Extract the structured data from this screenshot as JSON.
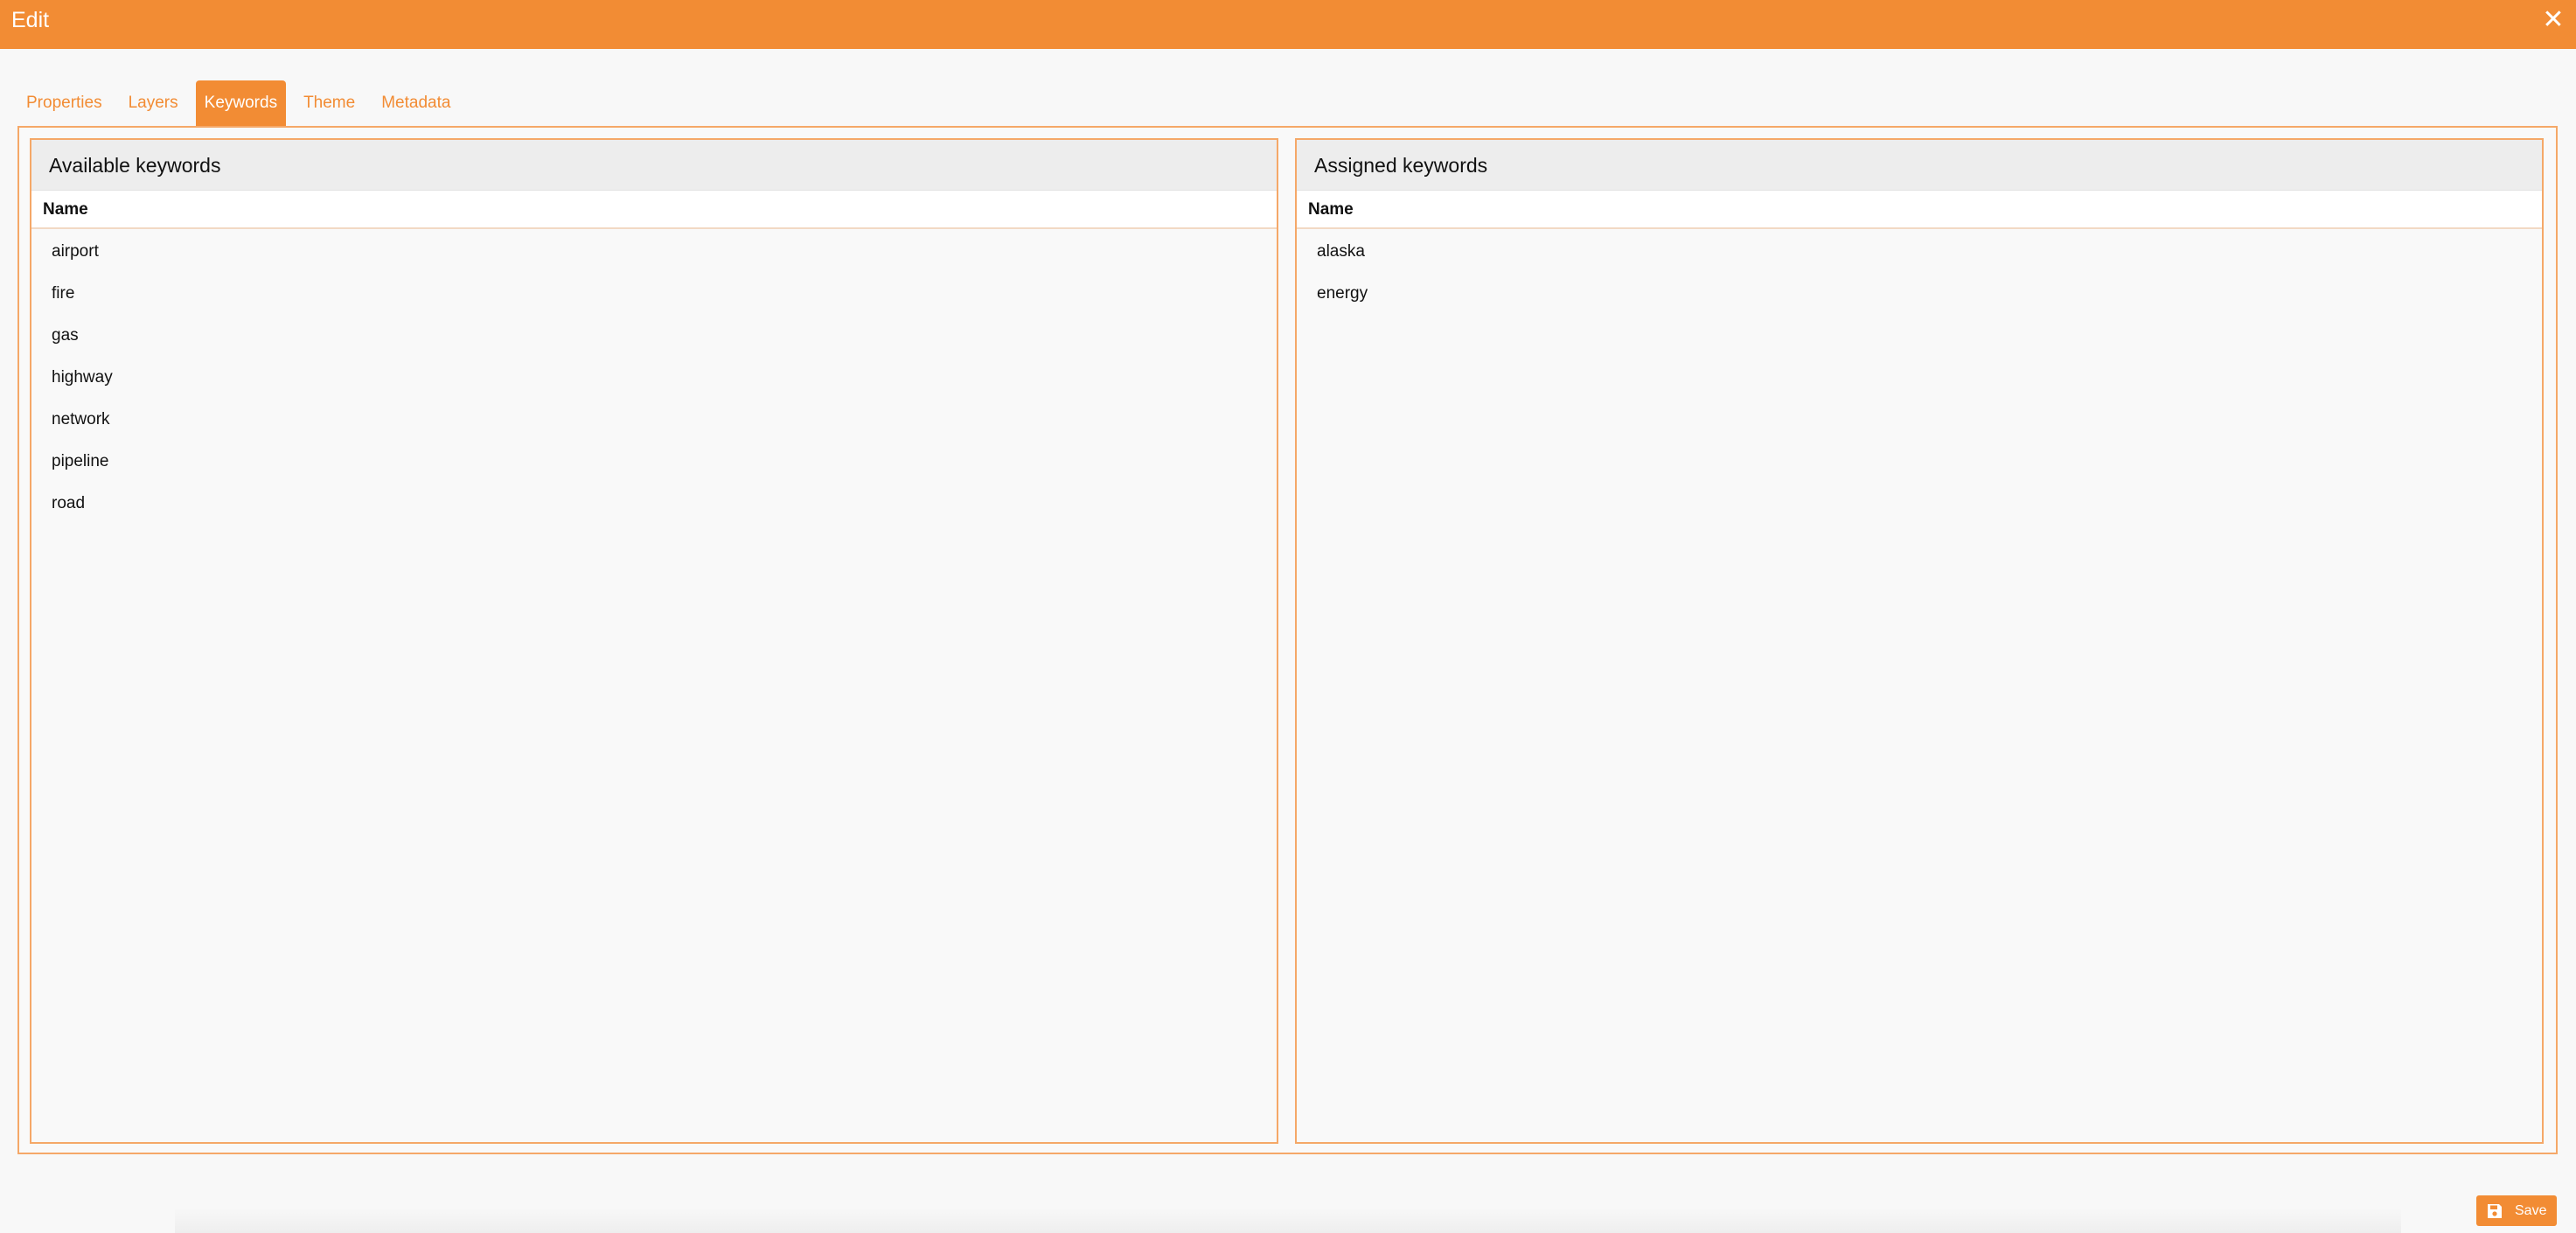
{
  "dialog": {
    "title": "Edit",
    "close_icon": "close-icon"
  },
  "tabs": [
    {
      "label": "Properties",
      "active": false
    },
    {
      "label": "Layers",
      "active": false
    },
    {
      "label": "Keywords",
      "active": true
    },
    {
      "label": "Theme",
      "active": false
    },
    {
      "label": "Metadata",
      "active": false
    }
  ],
  "available": {
    "title": "Available keywords",
    "column": "Name",
    "items": [
      "airport",
      "fire",
      "gas",
      "highway",
      "network",
      "pipeline",
      "road"
    ]
  },
  "assigned": {
    "title": "Assigned keywords",
    "column": "Name",
    "items": [
      "alaska",
      "energy"
    ]
  },
  "footer": {
    "save_label": "Save",
    "save_icon": "floppy-disk-icon"
  },
  "colors": {
    "accent": "#f28c34",
    "border": "#f5a868",
    "header_bg": "#ededed"
  }
}
